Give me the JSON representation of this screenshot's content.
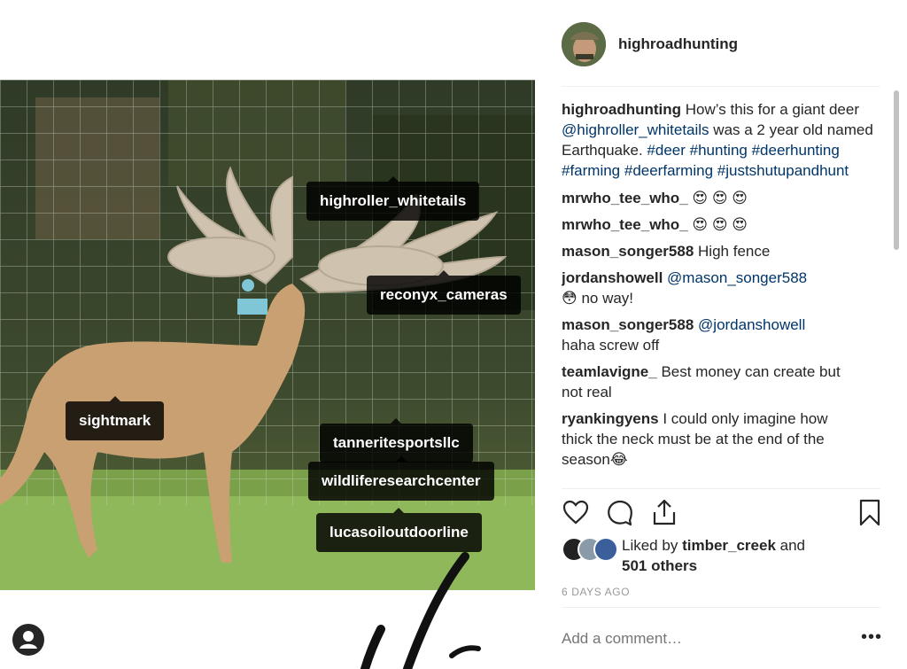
{
  "post": {
    "username": "highroadhunting",
    "caption": {
      "username": "highroadhunting",
      "text1": "How’s this for a giant deer",
      "mention": "@highroller_whitetails",
      "text2": "was a 2 year old named Earthquake.",
      "hashtags": "#deer #hunting #deerhunting #farming #deerfarming #justshutupandhunt"
    },
    "comments": [
      {
        "user": "mrwho_tee_who_",
        "text": "😍 😍 😍"
      },
      {
        "user": "mrwho_tee_who_",
        "text": "😍 😍 😍"
      },
      {
        "user": "mason_songer588",
        "text": "High fence"
      },
      {
        "user": "jordanshowell",
        "mention": "@mason_songer588",
        "text": "😳  no way!"
      },
      {
        "user": "mason_songer588",
        "mention": "@jordanshowell",
        "text": "haha screw off"
      },
      {
        "user": "teamlavigne_",
        "text": "Best money can create but not real"
      },
      {
        "user": "ryankingyens",
        "text": "I could only imagine how thick the neck must be at the end of the season😂"
      }
    ],
    "likes": {
      "prefix": "Liked by",
      "user": "timber_creek",
      "suffix": "and",
      "others": "501 others"
    },
    "date": "6 DAYS AGO",
    "add_comment_placeholder": "Add a comment…",
    "more_label": "•••"
  },
  "photo_tags": [
    {
      "label": "highroller_whitetails"
    },
    {
      "label": "reconyx_cameras"
    },
    {
      "label": "sightmark"
    },
    {
      "label": "tanneritesportsllc"
    },
    {
      "label": "wildliferesearchcenter"
    },
    {
      "label": "lucasoiloutdoorline"
    }
  ],
  "icons": {
    "like": "heart-icon",
    "comment": "comment-icon",
    "share": "share-icon",
    "save": "bookmark-icon",
    "user": "user-icon"
  },
  "colors": {
    "link": "#003569",
    "text": "#262626",
    "muted": "#999999"
  }
}
